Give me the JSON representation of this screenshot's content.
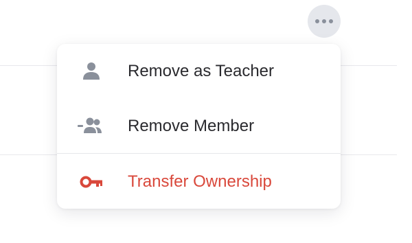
{
  "toolbar": {
    "more_icon": "more-horizontal-icon"
  },
  "menu": {
    "items": [
      {
        "label": "Remove as Teacher",
        "icon": "person-icon",
        "color": "#2a2a2e"
      },
      {
        "label": "Remove Member",
        "icon": "remove-member-icon",
        "color": "#2a2a2e"
      },
      {
        "label": "Transfer Ownership",
        "icon": "key-icon",
        "color": "#d9483b"
      }
    ]
  },
  "colors": {
    "icon_gray": "#8a909b",
    "danger": "#d9483b",
    "text": "#2a2a2e"
  }
}
